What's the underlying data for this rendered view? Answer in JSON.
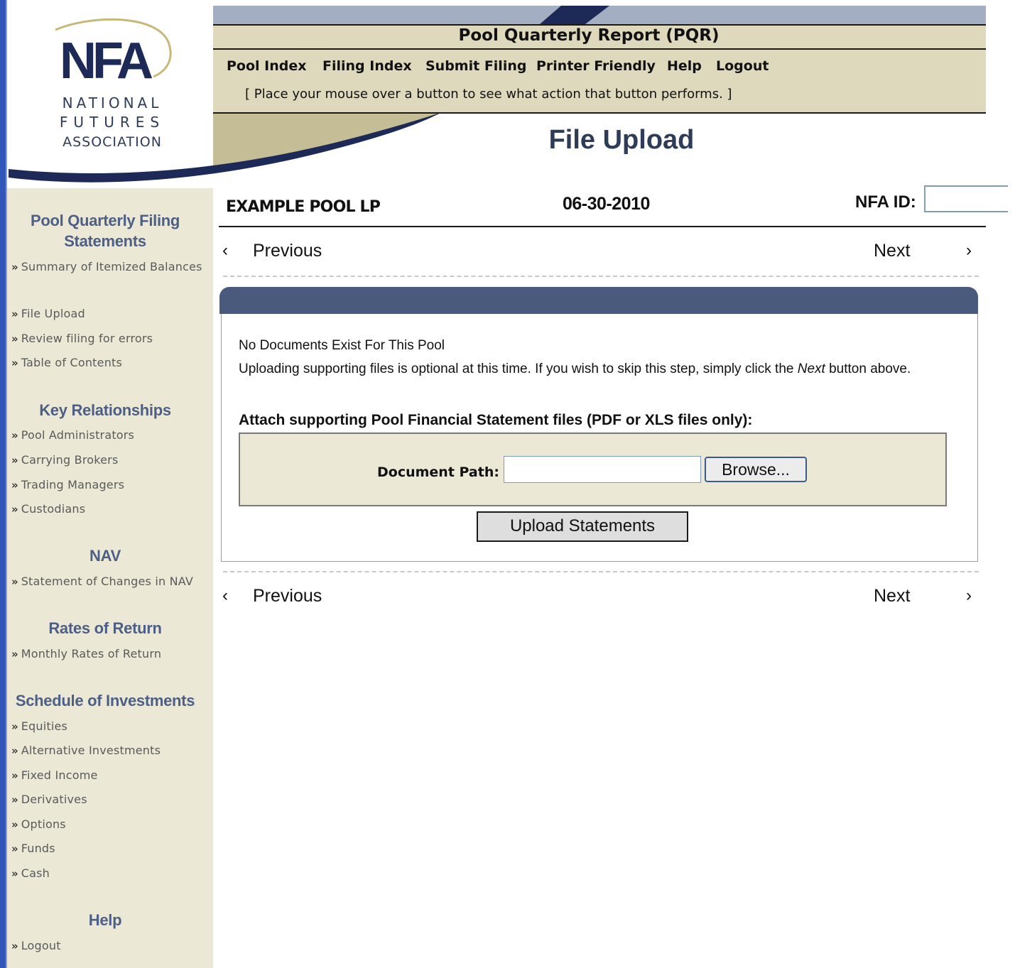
{
  "logo": {
    "mark": "NFA",
    "line1": "NATIONAL",
    "line2": "FUTURES",
    "line3": "ASSOCIATION"
  },
  "header": {
    "title": "Pool Quarterly Report (PQR)",
    "nav": [
      "Pool Index",
      "Filing Index",
      "Submit Filing",
      "Printer Friendly",
      "Help",
      "Logout"
    ],
    "hint": "[ Place your mouse over a button to see what action that button performs. ]"
  },
  "page": {
    "title": "File Upload",
    "pool_name": "EXAMPLE POOL LP",
    "date": "06-30-2010",
    "nfa_id_label": "NFA ID:",
    "nfa_id_value": ""
  },
  "pager": {
    "previous": "Previous",
    "next": "Next"
  },
  "sidebar": {
    "sections": [
      {
        "title": "Pool Quarterly Filing Statements",
        "links": [
          "Summary of Itemized Balances",
          "File Upload",
          "Review filing for errors",
          "Table of Contents"
        ]
      },
      {
        "title": "Key Relationships",
        "links": [
          "Pool Administrators",
          "Carrying Brokers",
          "Trading Managers",
          "Custodians"
        ]
      },
      {
        "title": "NAV",
        "links": [
          "Statement of Changes in NAV"
        ]
      },
      {
        "title": "Rates of Return",
        "links": [
          "Monthly Rates of Return"
        ]
      },
      {
        "title": "Schedule of Investments",
        "links": [
          "Equities",
          "Alternative Investments",
          "Fixed Income",
          "Derivatives",
          "Options",
          "Funds",
          "Cash"
        ]
      },
      {
        "title": "Help",
        "links": [
          "Logout"
        ]
      }
    ]
  },
  "upload": {
    "no_docs": "No Documents Exist For This Pool",
    "optional_before": "Uploading supporting files is optional at this time. If you wish to skip this step, simply click the ",
    "optional_em": "Next",
    "optional_after": " button above.",
    "attach_label": "Attach supporting Pool Financial Statement files (PDF or XLS files only):",
    "doc_path_label": "Document Path:",
    "doc_path_value": "",
    "browse_label": "Browse...",
    "upload_label": "Upload Statements"
  },
  "colors": {
    "sidebar_bg": "#ebe8d6",
    "header_bg": "#ded9bc",
    "panel_head": "#4a5a7c",
    "sidebar_heading": "#4d5f84",
    "accent_navy": "#1d2a57"
  }
}
